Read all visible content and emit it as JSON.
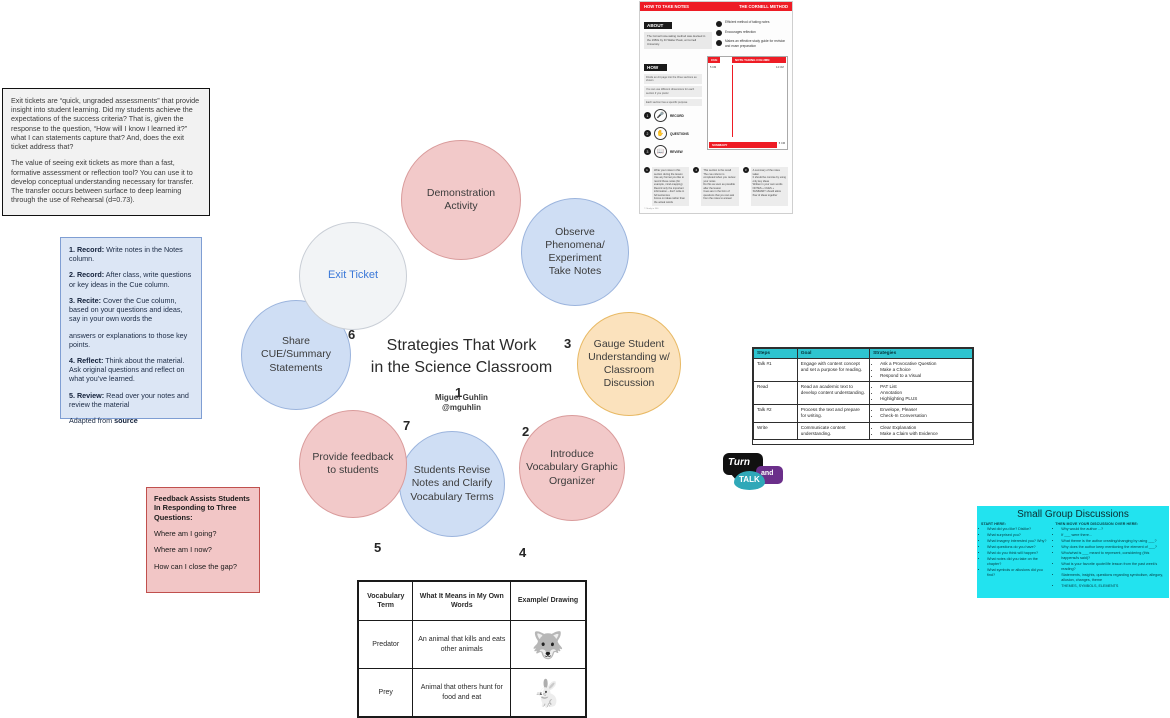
{
  "exit_ticket_note": {
    "paragraphs": [
      "Exit tickets are “quick, ungraded assessments” that provide insight into student learning. Did my students achieve the expectations of the success criteria? That is, given the response to the question, “How will I know I learned it?” what I can statements capture that? And, does the exit ticket address that?",
      "The value of seeing exit tickets as more than a fast, formative assessment or reflection tool? You can use it to develop conceptual understanding necessary for transfer. The transfer occurs between surface to deep learning through the use of Rehearsal (d=0.73)."
    ]
  },
  "cornell_steps_note": {
    "steps": [
      {
        "label": "1. Record:",
        "text": " Write notes in the Notes column."
      },
      {
        "label": "2. Record:",
        "text": " After class, write questions or key ideas in the Cue column."
      },
      {
        "label": "3. Recite:",
        "text": " Cover the Cue column, based on your questions and ideas, say in your own words the"
      }
    ],
    "continued": "answers or explanations to those key points.",
    "steps2": [
      {
        "label": "4. Reflect:",
        "text": " Think about the material. Ask original questions and reflect on what you’ve learned."
      },
      {
        "label": "5. Review:",
        "text": " Read over your notes and review the material"
      }
    ],
    "attribution_prefix": "Adapted from ",
    "attribution_link": "source"
  },
  "feedback_note": {
    "heading": "Feedback Assists Students In Responding to Three Questions:",
    "questions": [
      "Where am I going?",
      "Where am I now?",
      "How can I close the gap?"
    ]
  },
  "diagram": {
    "title_line1": "Strategies That Work",
    "title_line2": "in the Science Classroom",
    "credit_name": "Miguel Guhlin",
    "credit_handle": "@mguhlin",
    "petals": [
      {
        "id": "demonstration-activity",
        "lines": [
          "Demonstration",
          "Activity"
        ],
        "color": "#f2c9c9",
        "link": false
      },
      {
        "id": "observe-phenomena",
        "lines": [
          "Observe",
          "Phenomena/",
          "Experiment",
          "Take Notes"
        ],
        "color": "#cfdef4",
        "link": false
      },
      {
        "id": "gauge-student-understanding",
        "lines": [
          "Gauge Student",
          "Understanding w/",
          "Classroom",
          "Discussion"
        ],
        "color": "#fbe2bd",
        "link": false
      },
      {
        "id": "introduce-vocabulary",
        "lines": [
          "Introduce",
          "Vocabulary Graphic",
          "Organizer"
        ],
        "color": "#f2c9c9",
        "link": false
      },
      {
        "id": "students-revise-notes",
        "lines": [
          "Students Revise",
          "Notes and Clarify",
          "Vocabulary Terms"
        ],
        "color": "#cfdef4",
        "link": false
      },
      {
        "id": "provide-feedback",
        "lines": [
          "Provide feedback",
          "to students"
        ],
        "color": "#f2c9c9",
        "link": false
      },
      {
        "id": "share-cue-summary",
        "lines": [
          "Share",
          "CUE/Summary",
          "Statements"
        ],
        "color": "#cfdef4",
        "link": false
      },
      {
        "id": "exit-ticket",
        "lines": [
          "Exit Ticket"
        ],
        "color": "#f2f4f6",
        "link": true
      }
    ],
    "numbers": [
      "1",
      "2",
      "3",
      "4",
      "5",
      "6",
      "7"
    ]
  },
  "vocab_table": {
    "headers": [
      "Vocabulary Term",
      "What It Means in My Own Words",
      "Example/ Drawing"
    ],
    "rows": [
      {
        "term": "Predator",
        "meaning": "An animal that kills and eats other animals",
        "drawing_icon": "wolf-icon",
        "glyph": "🐺"
      },
      {
        "term": "Prey",
        "meaning": "Animal that others hunt for food and eat",
        "drawing_icon": "rabbit-icon",
        "glyph": "🐇"
      }
    ]
  },
  "steps_table": {
    "headers": [
      "Steps",
      "Goal",
      "Strategies"
    ],
    "rows": [
      {
        "step": "Talk #1",
        "goal": "Engage with content concept and set a purpose for reading.",
        "strategies": [
          "Ask a Provocative Question",
          "Make a Choice",
          "Respond to a Visual"
        ]
      },
      {
        "step": "Read",
        "goal": "Read an academic text to develop content understanding.",
        "strategies": [
          "PAT List",
          "Annotation",
          "Highlighting PLUS"
        ]
      },
      {
        "step": "Talk #2",
        "goal": "Process the text and prepare for writing.",
        "strategies": [
          "Envelope, Please!",
          "Check-In Conversation"
        ]
      },
      {
        "step": "Write",
        "goal": "Communicate content understanding.",
        "strategies": [
          "Clear Explanation",
          "Make a Claim with Evidence"
        ]
      }
    ],
    "header_color": "#2ec4cf"
  },
  "turn_talk_logo": {
    "turn": "Turn",
    "and": "and",
    "talk": "TALK"
  },
  "small_group": {
    "title": "Small Group Discussions",
    "left_heading": "START HERE:",
    "left_items": [
      "What did you like? Dislike?",
      "What surprised you?",
      "What imagery interested you? Why?",
      "What questions do you have?",
      "What do you think will happen?",
      "What notes did you take on the chapter?",
      "What symbols or allusions did you find?"
    ],
    "right_heading": "THEN MOVE YOUR DISCUSSION OVER HERE:",
    "right_items": [
      "Why would the author ...?",
      "If ___ were there...",
      "What theme is the author creating/changing by using ___?",
      "Why does the author keep mentioning the element of ___?",
      "Who/what is ___ meant to represent, considering (this happens/is said)?",
      "What is your favorite quote/life lesson from the past week's reading?",
      "Statements, insights, questions regarding symbolism, allegory, allusion, changes, theme",
      "THEMES, SYMBOLS, ELEMENTS"
    ],
    "background": "#22e3ef"
  },
  "cornell_infographic": {
    "title": "HOW TO TAKE NOTES",
    "subtitle": "THE CORNELL METHOD",
    "about_heading": "ABOUT",
    "about_text": "The Cornell note-taking method was devised in the 1950s by Dr Walter Pauk, at Cornell University.",
    "bullets": [
      "Efficient method of taking notes",
      "Encourages reflection",
      "Makes an effective study guide for revision and exam preparation"
    ],
    "how_heading": "HOW",
    "how_boxes": [
      "Divide an A4 page into the three sections as shown",
      "You can use different dimensions for each section if you prefer",
      "Each section has a specific purpose"
    ],
    "icons": [
      {
        "num": "1",
        "label": "RECORD",
        "icon": "microphone-icon",
        "glyph": "🎤"
      },
      {
        "num": "2",
        "label": "QUESTIONS",
        "icon": "question-hand-icon",
        "glyph": "✋"
      },
      {
        "num": "3",
        "label": "REVIEW",
        "icon": "book-review-icon",
        "glyph": "📖"
      }
    ],
    "page_cue_label": "CUE",
    "page_column_label": "NOTE TAKING COLUMN",
    "page_summary_label": "SUMMARY",
    "measure_cue": "5 CM",
    "measure_column": "14 CM",
    "measure_summary": "5 CM",
    "steps": [
      {
        "num": "1",
        "lines": [
          "Write your notes in this section during the lesson",
          "Use any format you like to record these notes (for example, mind-mapping)",
          "Record only the important information – don't write in full sentences",
          "Focus on ideas rather than the actual words"
        ]
      },
      {
        "num": "2",
        "lines": [
          "This section is the recall",
          "The cue column is completed when you review your notes",
          "Do this as soon as possible after the lesson",
          "Cues are in the form of questions that you can ask from the notes to answer"
        ]
      },
      {
        "num": "3",
        "lines": [
          "A summary of the notes taken",
          "It should be concise by using only key ideas",
          "Written in your own words",
          "NOTES + CUES + SUMMARY should allow flow of ideas together"
        ]
      }
    ],
    "footer": "© Study in 360"
  }
}
